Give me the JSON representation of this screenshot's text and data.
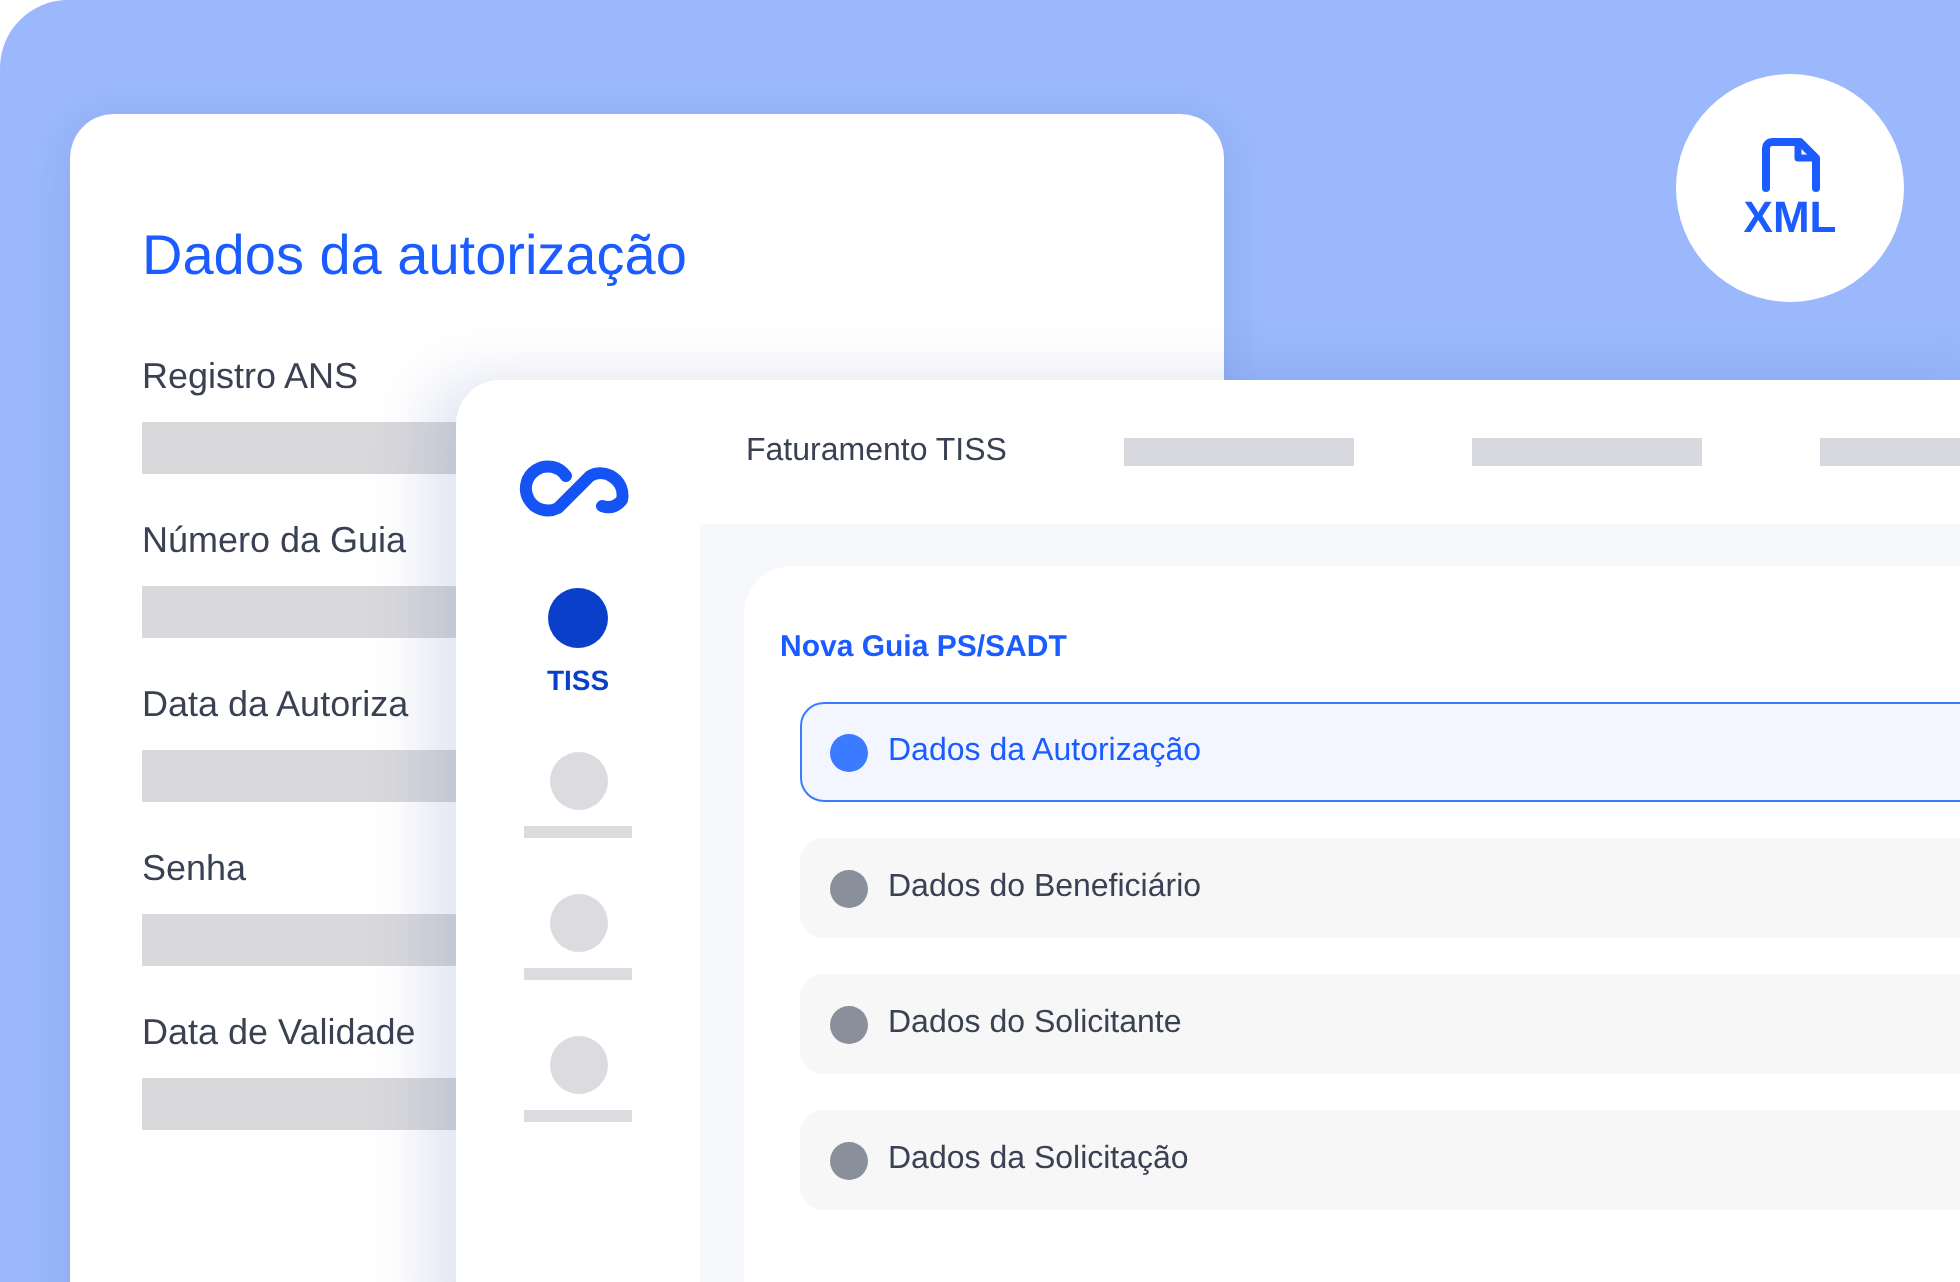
{
  "badge": {
    "text": "XML"
  },
  "back_card": {
    "title": "Dados da autorização",
    "fields": [
      {
        "label": "Registro ANS"
      },
      {
        "label": "Número da Guia"
      },
      {
        "label": "Data da Autoriza"
      },
      {
        "label": "Senha"
      },
      {
        "label": "Data de Validade"
      }
    ]
  },
  "app": {
    "nav": [
      {
        "label": "TISS",
        "selected": true
      }
    ],
    "header": {
      "title": "Faturamento TISS"
    },
    "panel": {
      "title": "Nova Guia PS/SADT",
      "steps": [
        {
          "label": "Dados da Autorização",
          "selected": true
        },
        {
          "label": "Dados do Beneficiário",
          "selected": false
        },
        {
          "label": "Dados do Solicitante",
          "selected": false
        },
        {
          "label": "Dados da Solicitação",
          "selected": false
        }
      ]
    }
  }
}
